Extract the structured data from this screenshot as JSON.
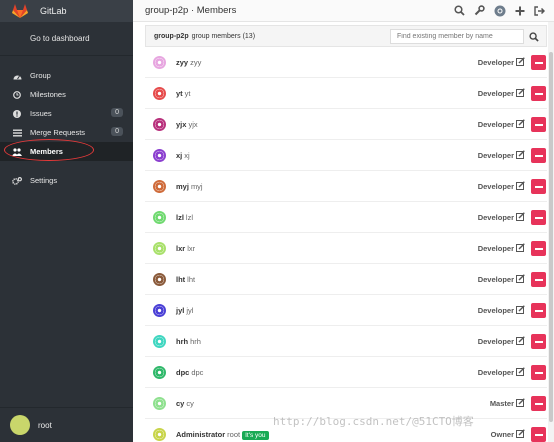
{
  "sidebar": {
    "brand": "GitLab",
    "dashboard_link": "Go to dashboard",
    "items": [
      {
        "label": "Group",
        "icon": "dashboard-icon"
      },
      {
        "label": "Milestones",
        "icon": "clock-icon"
      },
      {
        "label": "Issues",
        "icon": "exclamation-circle-icon",
        "count": "0"
      },
      {
        "label": "Merge Requests",
        "icon": "list-icon",
        "count": "0"
      },
      {
        "label": "Members",
        "icon": "users-icon"
      },
      {
        "label": "Settings",
        "icon": "cogs-icon"
      }
    ],
    "user": "root"
  },
  "header": {
    "title": "group-p2p · Members"
  },
  "panel": {
    "group": "group-p2p",
    "label": "group members (13)",
    "search_placeholder": "Find existing member by name"
  },
  "members": [
    {
      "username": "zyy",
      "name": "zyy",
      "role": "Developer",
      "color": "#e7a6e0"
    },
    {
      "username": "yt",
      "name": "yt",
      "role": "Developer",
      "color": "#e64b4b"
    },
    {
      "username": "yjx",
      "name": "yjx",
      "role": "Developer",
      "color": "#b8307c"
    },
    {
      "username": "xj",
      "name": "xj",
      "role": "Developer",
      "color": "#8b3fcf"
    },
    {
      "username": "myj",
      "name": "myj",
      "role": "Developer",
      "color": "#cf6b3a"
    },
    {
      "username": "lzl",
      "name": "lzl",
      "role": "Developer",
      "color": "#6fd96f"
    },
    {
      "username": "lxr",
      "name": "lxr",
      "role": "Developer",
      "color": "#a8e06a"
    },
    {
      "username": "lht",
      "name": "lht",
      "role": "Developer",
      "color": "#8a5a3a"
    },
    {
      "username": "jyl",
      "name": "jyl",
      "role": "Developer",
      "color": "#4a3fd6"
    },
    {
      "username": "hrh",
      "name": "hrh",
      "role": "Developer",
      "color": "#3fd6c0"
    },
    {
      "username": "dpc",
      "name": "dpc",
      "role": "Developer",
      "color": "#2fb86a"
    },
    {
      "username": "cy",
      "name": "cy",
      "role": "Master",
      "color": "#8ee08e"
    },
    {
      "username": "Administrator",
      "name": "root",
      "role": "Owner",
      "color": "#c8d44a",
      "its_you": "It's you"
    }
  ],
  "watermark": "http://blog.csdn.net/@51CTO博客"
}
